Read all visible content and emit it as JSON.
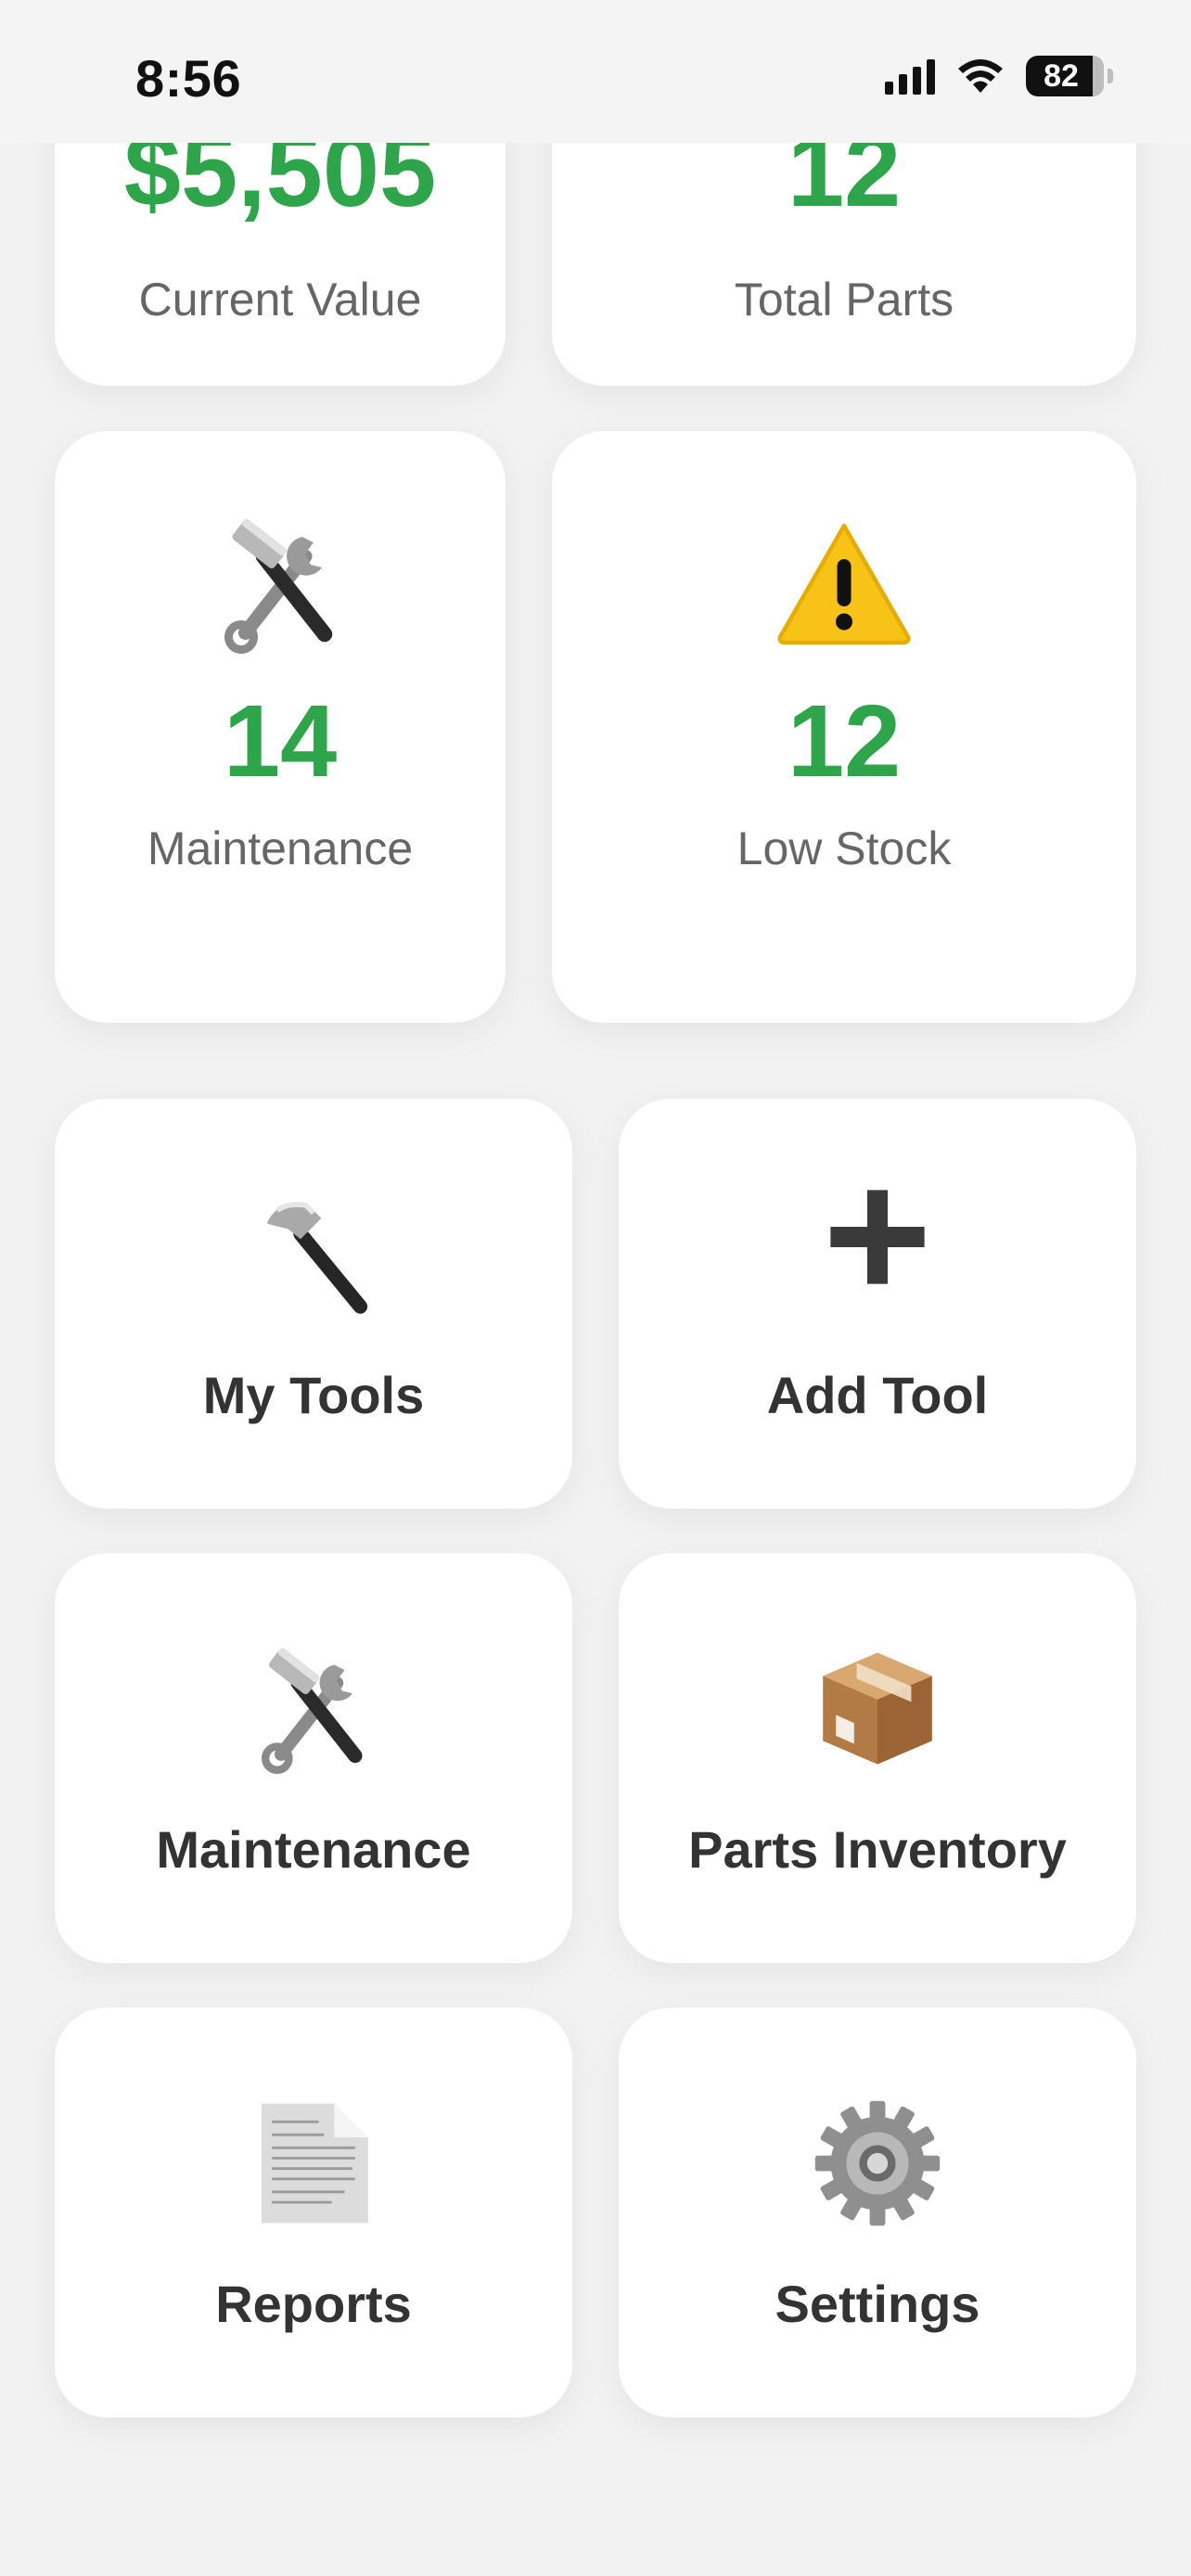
{
  "status_bar": {
    "time": "8:56",
    "battery": "82",
    "icons": [
      "cellular-signal-icon",
      "wifi-icon",
      "battery-icon"
    ]
  },
  "stats": [
    {
      "value": "$5,505",
      "label": "Current Value",
      "icon": "none"
    },
    {
      "value": "12",
      "label": "Total Parts",
      "icon": "none"
    },
    {
      "value": "14",
      "label": "Maintenance",
      "icon": "hammer-wrench-icon"
    },
    {
      "value": "12",
      "label": "Low Stock",
      "icon": "warning-icon"
    }
  ],
  "menu": [
    {
      "label": "My Tools",
      "icon": "hammer-icon"
    },
    {
      "label": "Add Tool",
      "icon": "plus-icon",
      "glyph": "✚"
    },
    {
      "label": "Maintenance",
      "icon": "hammer-wrench-icon"
    },
    {
      "label": "Parts Inventory",
      "icon": "package-icon"
    },
    {
      "label": "Reports",
      "icon": "document-icon"
    },
    {
      "label": "Settings",
      "icon": "gear-icon"
    }
  ],
  "colors": {
    "accent_green": "#2ea54a",
    "background": "#f1f2f1",
    "card": "#ffffff",
    "label_gray": "#666666",
    "menu_text": "#333333"
  }
}
